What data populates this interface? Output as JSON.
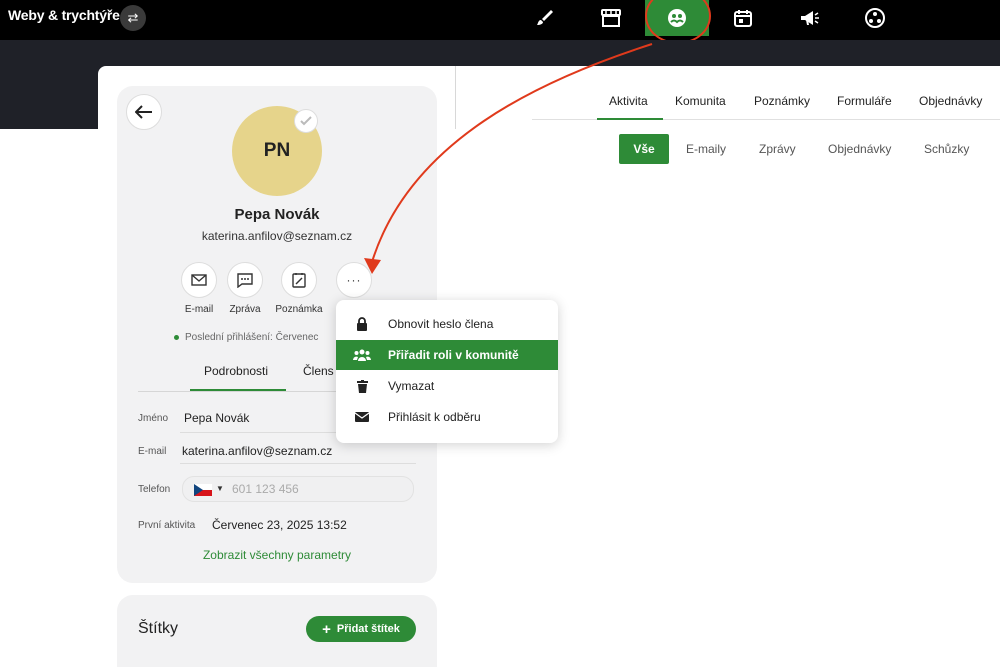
{
  "topbar": {
    "brand": "Weby & trychtýře",
    "nav_icons": [
      "brush-icon",
      "store-icon",
      "community-icon",
      "calendar-icon",
      "megaphone-icon",
      "network-icon"
    ],
    "active_nav": "community-icon",
    "accent": "#2e8b37",
    "annotation_color": "#e03a1c"
  },
  "profile": {
    "initials": "PN",
    "name": "Pepa Novák",
    "email": "katerina.anfilov@seznam.cz",
    "actions": [
      "E-mail",
      "Zpráva",
      "Poznámka"
    ],
    "more_label": "···",
    "last_login": "Poslední přihlášení: Červenec",
    "tabs": [
      "Podrobnosti",
      "Člens"
    ]
  },
  "fields": {
    "name_label": "Jméno",
    "name_value": "Pepa Novák",
    "email_label": "E-mail",
    "email_value": "katerina.anfilov@seznam.cz",
    "phone_label": "Telefon",
    "phone_placeholder": "601 123 456",
    "first_activity_label": "První aktivita",
    "first_activity_value": "Červenec 23, 2025 13:52",
    "show_all": "Zobrazit všechny parametry"
  },
  "tags": {
    "title": "Štítky",
    "add_label": "Přidat štítek"
  },
  "right_tabs": [
    "Aktivita",
    "Komunita",
    "Poznámky",
    "Formuláře",
    "Objednávky"
  ],
  "sub_filters": [
    "Vše",
    "E-maily",
    "Zprávy",
    "Objednávky",
    "Schůzky"
  ],
  "menu": {
    "items": [
      {
        "label": "Obnovit heslo člena",
        "icon": "lock-icon"
      },
      {
        "label": "Přiřadit roli v komunitě",
        "icon": "users-icon"
      },
      {
        "label": "Vymazat",
        "icon": "trash-icon"
      },
      {
        "label": "Přihlásit k odběru",
        "icon": "envelope-icon"
      }
    ],
    "active_index": 1
  }
}
